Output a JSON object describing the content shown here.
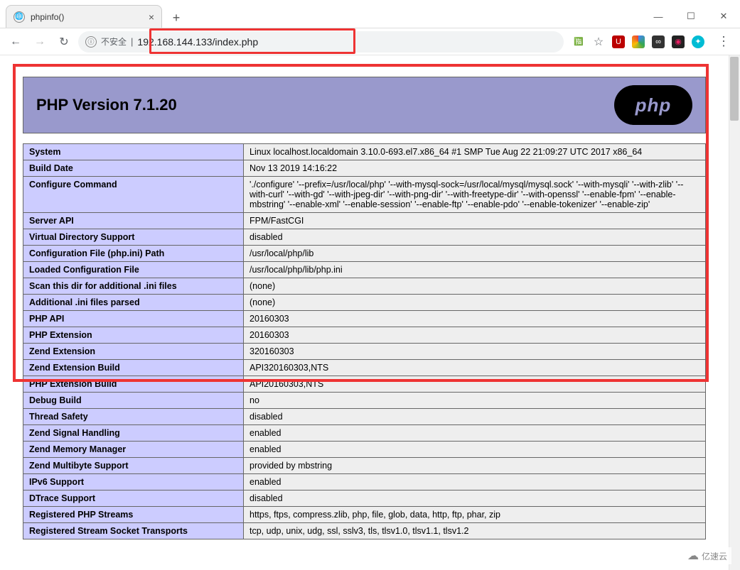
{
  "browser": {
    "tab_title": "phpinfo()",
    "new_tab_glyph": "+",
    "close_glyph": "×",
    "url_prefix_insecure": "不安全",
    "url": "192.168.144.133/index.php",
    "win": {
      "min": "—",
      "max": "☐",
      "close": "✕"
    },
    "nav": {
      "back": "←",
      "forward": "→",
      "reload": "↻"
    },
    "info_glyph": "ⓘ",
    "translate_glyph": "🈯",
    "star_glyph": "☆",
    "kebab": "⋮"
  },
  "ext_colors": {
    "ublock": "#b00",
    "gdrive": "linear-gradient(45deg,#4285f4,#34a853,#fbbc05,#ea4335)",
    "vpn": "#333",
    "cam": "#222",
    "custom": "#00bcd4"
  },
  "header_title": "PHP Version 7.1.20",
  "logo_text": "php",
  "rows": [
    {
      "k": "System",
      "v": "Linux localhost.localdomain 3.10.0-693.el7.x86_64 #1 SMP Tue Aug 22 21:09:27 UTC 2017 x86_64"
    },
    {
      "k": "Build Date",
      "v": "Nov 13 2019 14:16:22"
    },
    {
      "k": "Configure Command",
      "v": "'./configure' '--prefix=/usr/local/php' '--with-mysql-sock=/usr/local/mysql/mysql.sock' '--with-mysqli' '--with-zlib' '--with-curl' '--with-gd' '--with-jpeg-dir' '--with-png-dir' '--with-freetype-dir' '--with-openssl' '--enable-fpm' '--enable-mbstring' '--enable-xml' '--enable-session' '--enable-ftp' '--enable-pdo' '--enable-tokenizer' '--enable-zip'"
    },
    {
      "k": "Server API",
      "v": "FPM/FastCGI"
    },
    {
      "k": "Virtual Directory Support",
      "v": "disabled"
    },
    {
      "k": "Configuration File (php.ini) Path",
      "v": "/usr/local/php/lib"
    },
    {
      "k": "Loaded Configuration File",
      "v": "/usr/local/php/lib/php.ini"
    },
    {
      "k": "Scan this dir for additional .ini files",
      "v": "(none)"
    },
    {
      "k": "Additional .ini files parsed",
      "v": "(none)"
    },
    {
      "k": "PHP API",
      "v": "20160303"
    },
    {
      "k": "PHP Extension",
      "v": "20160303"
    },
    {
      "k": "Zend Extension",
      "v": "320160303"
    },
    {
      "k": "Zend Extension Build",
      "v": "API320160303,NTS"
    },
    {
      "k": "PHP Extension Build",
      "v": "API20160303,NTS"
    },
    {
      "k": "Debug Build",
      "v": "no"
    },
    {
      "k": "Thread Safety",
      "v": "disabled"
    },
    {
      "k": "Zend Signal Handling",
      "v": "enabled"
    },
    {
      "k": "Zend Memory Manager",
      "v": "enabled"
    },
    {
      "k": "Zend Multibyte Support",
      "v": "provided by mbstring"
    },
    {
      "k": "IPv6 Support",
      "v": "enabled"
    },
    {
      "k": "DTrace Support",
      "v": "disabled"
    },
    {
      "k": "Registered PHP Streams",
      "v": "https, ftps, compress.zlib, php, file, glob, data, http, ftp, phar, zip"
    },
    {
      "k": "Registered Stream Socket Transports",
      "v": "tcp, udp, unix, udg, ssl, sslv3, tls, tlsv1.0, tlsv1.1, tlsv1.2"
    }
  ],
  "watermark": "亿速云"
}
